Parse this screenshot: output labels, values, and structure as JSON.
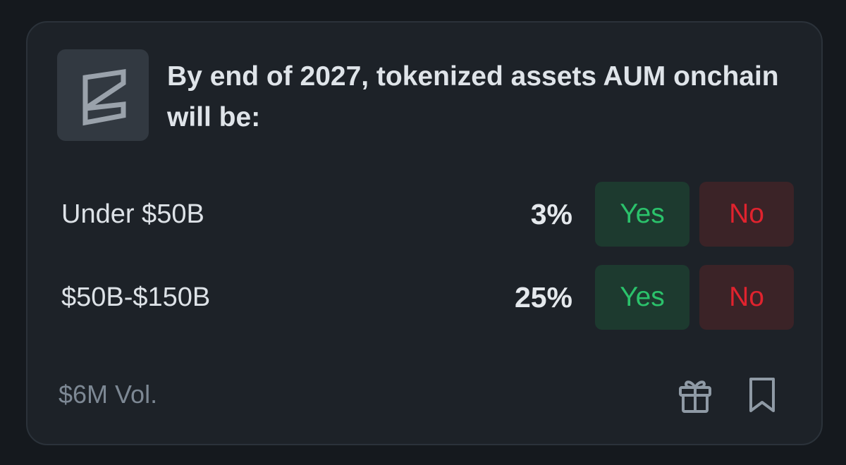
{
  "market": {
    "logo_icon": "kalshi-like-hexagon-logo-icon",
    "question": "By end of 2027, tokenized assets AUM onchain will be:",
    "outcomes": [
      {
        "label": "Under $50B",
        "percent": "3%",
        "yes_label": "Yes",
        "no_label": "No"
      },
      {
        "label": "$50B-$150B",
        "percent": "25%",
        "yes_label": "Yes",
        "no_label": "No"
      }
    ],
    "volume": "$6M Vol.",
    "footer_icons": [
      "gift-icon",
      "bookmark-icon"
    ]
  },
  "colors": {
    "page_background": "#15191e",
    "card_background": "#1d2228",
    "yes_text": "#2bc26b",
    "yes_background": "#1d3a2f",
    "no_text": "#e0232e",
    "no_background": "#3b2327",
    "muted_text": "#7d8894"
  }
}
